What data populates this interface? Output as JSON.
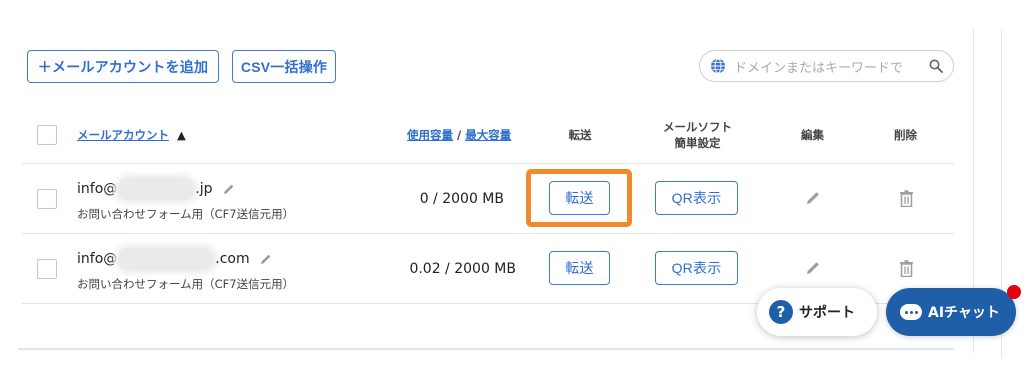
{
  "toolbar": {
    "add_account_label": "＋メールアカウントを追加",
    "csv_label": "CSV一括操作"
  },
  "search": {
    "placeholder": "ドメインまたはキーワードで"
  },
  "table": {
    "headers": {
      "account": "メールアカウント",
      "sort_indicator": "▲",
      "usage": "使用容量",
      "separator": " / ",
      "max": "最大容量",
      "forward": "転送",
      "mail_soft_line1": "メールソフト",
      "mail_soft_line2": "簡単設定",
      "edit": "編集",
      "delete": "削除"
    },
    "rows": [
      {
        "account_prefix": "info@",
        "account_suffix": ".jp",
        "purpose": "お問い合わせフォーム用（CF7送信元用）",
        "quota": "0 / 2000 MB",
        "forward_label": "転送",
        "qr_label": "QR表示"
      },
      {
        "account_prefix": "info@",
        "account_suffix": ".com",
        "purpose": "お問い合わせフォーム用（CF7送信元用）",
        "quota": "0.02 / 2000 MB",
        "forward_label": "転送",
        "qr_label": "QR表示"
      }
    ]
  },
  "floating": {
    "support_label": "サポート",
    "support_icon_text": "?",
    "ai_chat_label": "AIチャット"
  },
  "colors": {
    "accent": "#2f6fd1",
    "highlight": "#f08a2c",
    "chat_bg": "#1f5fa8",
    "notification": "#e60012"
  }
}
